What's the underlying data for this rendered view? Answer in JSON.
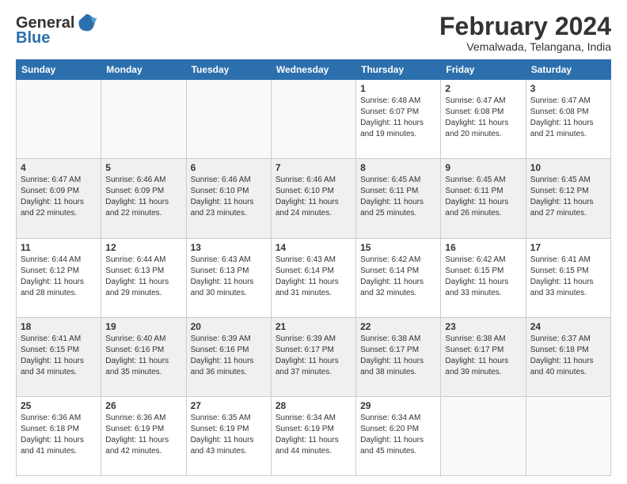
{
  "header": {
    "logo_general": "General",
    "logo_blue": "Blue",
    "month_title": "February 2024",
    "location": "Vemalwada, Telangana, India"
  },
  "days_of_week": [
    "Sunday",
    "Monday",
    "Tuesday",
    "Wednesday",
    "Thursday",
    "Friday",
    "Saturday"
  ],
  "weeks": [
    [
      {
        "day": "",
        "info": ""
      },
      {
        "day": "",
        "info": ""
      },
      {
        "day": "",
        "info": ""
      },
      {
        "day": "",
        "info": ""
      },
      {
        "day": "1",
        "info": "Sunrise: 6:48 AM\nSunset: 6:07 PM\nDaylight: 11 hours and 19 minutes."
      },
      {
        "day": "2",
        "info": "Sunrise: 6:47 AM\nSunset: 6:08 PM\nDaylight: 11 hours and 20 minutes."
      },
      {
        "day": "3",
        "info": "Sunrise: 6:47 AM\nSunset: 6:08 PM\nDaylight: 11 hours and 21 minutes."
      }
    ],
    [
      {
        "day": "4",
        "info": "Sunrise: 6:47 AM\nSunset: 6:09 PM\nDaylight: 11 hours and 22 minutes."
      },
      {
        "day": "5",
        "info": "Sunrise: 6:46 AM\nSunset: 6:09 PM\nDaylight: 11 hours and 22 minutes."
      },
      {
        "day": "6",
        "info": "Sunrise: 6:46 AM\nSunset: 6:10 PM\nDaylight: 11 hours and 23 minutes."
      },
      {
        "day": "7",
        "info": "Sunrise: 6:46 AM\nSunset: 6:10 PM\nDaylight: 11 hours and 24 minutes."
      },
      {
        "day": "8",
        "info": "Sunrise: 6:45 AM\nSunset: 6:11 PM\nDaylight: 11 hours and 25 minutes."
      },
      {
        "day": "9",
        "info": "Sunrise: 6:45 AM\nSunset: 6:11 PM\nDaylight: 11 hours and 26 minutes."
      },
      {
        "day": "10",
        "info": "Sunrise: 6:45 AM\nSunset: 6:12 PM\nDaylight: 11 hours and 27 minutes."
      }
    ],
    [
      {
        "day": "11",
        "info": "Sunrise: 6:44 AM\nSunset: 6:12 PM\nDaylight: 11 hours and 28 minutes."
      },
      {
        "day": "12",
        "info": "Sunrise: 6:44 AM\nSunset: 6:13 PM\nDaylight: 11 hours and 29 minutes."
      },
      {
        "day": "13",
        "info": "Sunrise: 6:43 AM\nSunset: 6:13 PM\nDaylight: 11 hours and 30 minutes."
      },
      {
        "day": "14",
        "info": "Sunrise: 6:43 AM\nSunset: 6:14 PM\nDaylight: 11 hours and 31 minutes."
      },
      {
        "day": "15",
        "info": "Sunrise: 6:42 AM\nSunset: 6:14 PM\nDaylight: 11 hours and 32 minutes."
      },
      {
        "day": "16",
        "info": "Sunrise: 6:42 AM\nSunset: 6:15 PM\nDaylight: 11 hours and 33 minutes."
      },
      {
        "day": "17",
        "info": "Sunrise: 6:41 AM\nSunset: 6:15 PM\nDaylight: 11 hours and 33 minutes."
      }
    ],
    [
      {
        "day": "18",
        "info": "Sunrise: 6:41 AM\nSunset: 6:15 PM\nDaylight: 11 hours and 34 minutes."
      },
      {
        "day": "19",
        "info": "Sunrise: 6:40 AM\nSunset: 6:16 PM\nDaylight: 11 hours and 35 minutes."
      },
      {
        "day": "20",
        "info": "Sunrise: 6:39 AM\nSunset: 6:16 PM\nDaylight: 11 hours and 36 minutes."
      },
      {
        "day": "21",
        "info": "Sunrise: 6:39 AM\nSunset: 6:17 PM\nDaylight: 11 hours and 37 minutes."
      },
      {
        "day": "22",
        "info": "Sunrise: 6:38 AM\nSunset: 6:17 PM\nDaylight: 11 hours and 38 minutes."
      },
      {
        "day": "23",
        "info": "Sunrise: 6:38 AM\nSunset: 6:17 PM\nDaylight: 11 hours and 39 minutes."
      },
      {
        "day": "24",
        "info": "Sunrise: 6:37 AM\nSunset: 6:18 PM\nDaylight: 11 hours and 40 minutes."
      }
    ],
    [
      {
        "day": "25",
        "info": "Sunrise: 6:36 AM\nSunset: 6:18 PM\nDaylight: 11 hours and 41 minutes."
      },
      {
        "day": "26",
        "info": "Sunrise: 6:36 AM\nSunset: 6:19 PM\nDaylight: 11 hours and 42 minutes."
      },
      {
        "day": "27",
        "info": "Sunrise: 6:35 AM\nSunset: 6:19 PM\nDaylight: 11 hours and 43 minutes."
      },
      {
        "day": "28",
        "info": "Sunrise: 6:34 AM\nSunset: 6:19 PM\nDaylight: 11 hours and 44 minutes."
      },
      {
        "day": "29",
        "info": "Sunrise: 6:34 AM\nSunset: 6:20 PM\nDaylight: 11 hours and 45 minutes."
      },
      {
        "day": "",
        "info": ""
      },
      {
        "day": "",
        "info": ""
      }
    ]
  ]
}
